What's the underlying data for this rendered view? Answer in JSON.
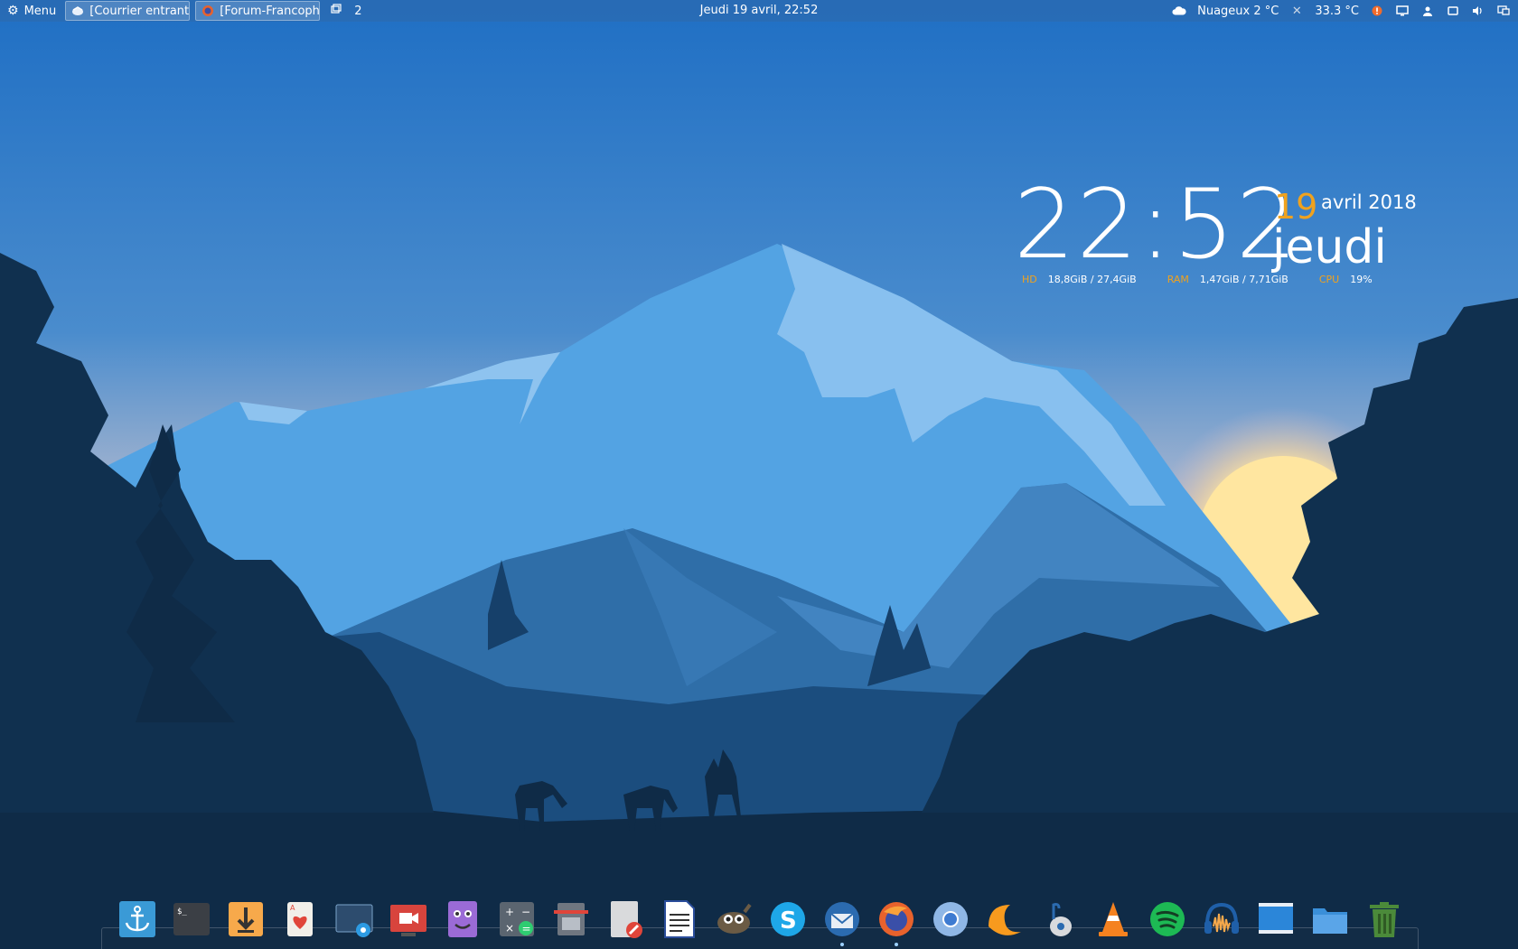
{
  "panel": {
    "menu_label": "Menu",
    "tasks": [
      {
        "label": "[Courrier entrant..."
      },
      {
        "label": "[Forum-Francoph..."
      }
    ],
    "workspace_count": "2",
    "datetime": "Jeudi 19 avril, 22:52",
    "weather": "Nuageux 2 °C",
    "temperature": "33.3 °C"
  },
  "conky": {
    "time": "22:52",
    "day_number": "19",
    "month_year": "avril 2018",
    "weekday": "jeudi",
    "hd_label": "HD",
    "hd_value": "18,8GiB / 27,4GiB",
    "ram_label": "RAM",
    "ram_value": "1,47GiB / 7,71GiB",
    "cpu_label": "CPU",
    "cpu_value": "19%"
  },
  "colors": {
    "accent": "#f0a21e",
    "panel": "#3068aa"
  },
  "dock": {
    "items": [
      {
        "icon": "anchor-icon"
      },
      {
        "icon": "terminal-icon"
      },
      {
        "icon": "download-icon"
      },
      {
        "icon": "cards-icon"
      },
      {
        "icon": "screenshot-icon"
      },
      {
        "icon": "screen-recorder-icon"
      },
      {
        "icon": "face-app-icon"
      },
      {
        "icon": "calculator-icon"
      },
      {
        "icon": "archive-icon"
      },
      {
        "icon": "text-editor-icon"
      },
      {
        "icon": "writer-document-icon"
      },
      {
        "icon": "gimp-icon"
      },
      {
        "icon": "skype-icon"
      },
      {
        "icon": "thunderbird-icon",
        "running": true
      },
      {
        "icon": "firefox-icon",
        "running": true
      },
      {
        "icon": "chromium-icon"
      },
      {
        "icon": "clementine-icon"
      },
      {
        "icon": "music-player-icon"
      },
      {
        "icon": "vlc-icon"
      },
      {
        "icon": "spotify-icon"
      },
      {
        "icon": "audacity-icon"
      },
      {
        "icon": "desktop-window-icon"
      },
      {
        "icon": "folder-icon"
      },
      {
        "icon": "trash-icon"
      }
    ]
  }
}
